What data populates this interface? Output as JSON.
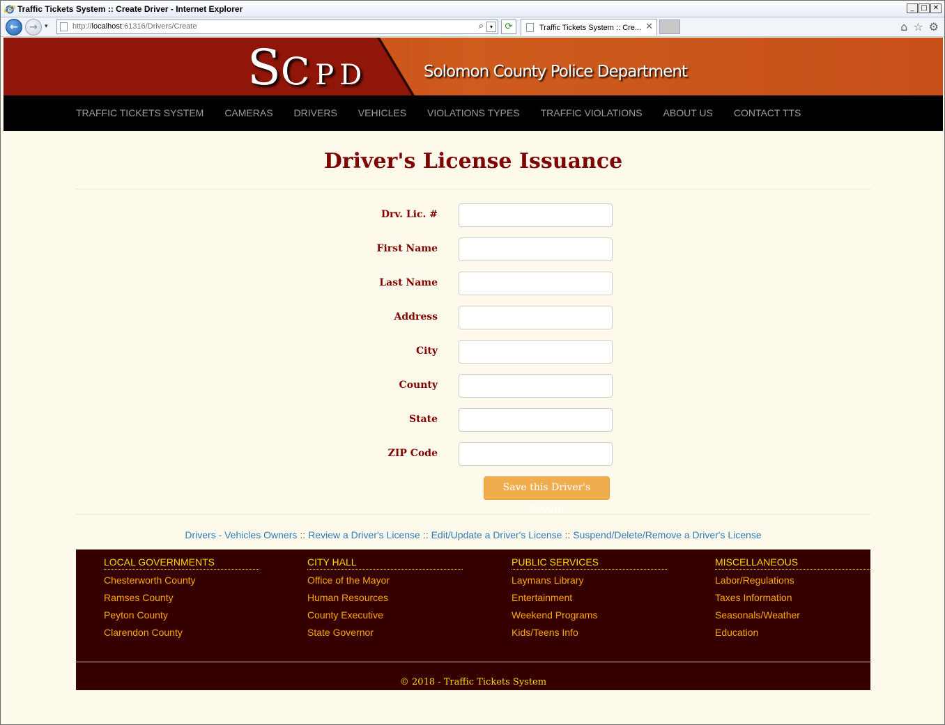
{
  "window": {
    "title": "Traffic Tickets System :: Create Driver - Internet Explorer",
    "buttons": [
      "_",
      "□",
      "✕"
    ]
  },
  "ie": {
    "url_prefix": "http://",
    "url_host": "localhost",
    "url_rest": ":61316/Drivers/Create",
    "tab_title": "Traffic Tickets System :: Cre...",
    "tab_close": "✕",
    "search_glyph": "⌕",
    "dropdown_glyph": "▾",
    "refresh_glyph": "⟳",
    "back_glyph": "←",
    "forward_glyph": "→",
    "home_glyph": "⌂",
    "favorites_glyph": "☆",
    "tools_glyph": "⚙"
  },
  "banner": {
    "logo_s": "S",
    "logo_c": "C",
    "logo_p": "P",
    "logo_d": "D",
    "title": "Solomon County Police Department"
  },
  "nav": {
    "items": [
      "TRAFFIC TICKETS SYSTEM",
      "CAMERAS",
      "DRIVERS",
      "VEHICLES",
      "VIOLATIONS TYPES",
      "TRAFFIC VIOLATIONS",
      "ABOUT US",
      "CONTACT TTS"
    ]
  },
  "page": {
    "title": "Driver's License Issuance",
    "fields": [
      {
        "label": "Drv. Lic. #",
        "value": ""
      },
      {
        "label": "First Name",
        "value": ""
      },
      {
        "label": "Last Name",
        "value": ""
      },
      {
        "label": "Address",
        "value": ""
      },
      {
        "label": "City",
        "value": ""
      },
      {
        "label": "County",
        "value": ""
      },
      {
        "label": "State",
        "value": ""
      },
      {
        "label": "ZIP Code",
        "value": ""
      }
    ],
    "save_label": "Save this Driver's Record",
    "links": [
      "Drivers - Vehicles Owners",
      "Review a Driver's License",
      "Edit/Update a Driver's License",
      "Suspend/Delete/Remove a Driver's License"
    ],
    "link_separator": "::"
  },
  "footer": {
    "columns": [
      {
        "heading": "LOCAL GOVERNMENTS",
        "items": [
          "Chesterworth County",
          "Ramses County",
          "Peyton County",
          "Clarendon County"
        ]
      },
      {
        "heading": "CITY HALL",
        "items": [
          "Office of the Mayor",
          "Human Resources",
          "County Executive",
          "State Governor"
        ]
      },
      {
        "heading": "PUBLIC SERVICES",
        "items": [
          "Laymans Library",
          "Entertainment",
          "Weekend Programs",
          "Kids/Teens Info"
        ]
      },
      {
        "heading": "MISCELLANEOUS",
        "items": [
          "Labor/Regulations",
          "Taxes Information",
          "Seasonals/Weather",
          "Education"
        ]
      }
    ],
    "copyright": "© 2018 - Traffic Tickets System"
  },
  "colors": {
    "brand_dark_red": "#800000",
    "banner_red": "#8f1608",
    "banner_orange": "#c2410c",
    "footer_bg": "#340000",
    "footer_heading": "#ffd700",
    "footer_link": "#ffa500",
    "button_orange": "#f0ad4e",
    "link_blue": "#337ab7"
  }
}
